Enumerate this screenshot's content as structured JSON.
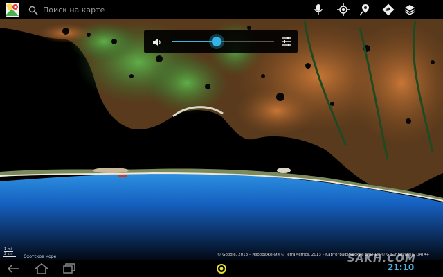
{
  "search": {
    "placeholder": "Поиск на карте"
  },
  "toolbar": {
    "icons": [
      "maps-app-icon",
      "search-icon",
      "microphone-icon",
      "my-location-icon",
      "places-icon",
      "directions-icon",
      "layers-icon"
    ]
  },
  "volume": {
    "level": 0.44,
    "accent": "#33b5e5"
  },
  "map": {
    "sea_label": "Охотское море",
    "scale_upper": "1 mi",
    "scale_lower": "2 km",
    "attribution": "© Google, 2013 – Изображения © TerraMetrics, 2013 – Картографические данные © GIS Innovatsia, DATA+"
  },
  "status": {
    "clock": "21:10"
  },
  "watermark": "SAKH.COM",
  "colors": {
    "water": "#02060a",
    "sea_blue": "#1a68c8",
    "land_orange": "#b0652c",
    "land_green": "#3e8a3a"
  }
}
